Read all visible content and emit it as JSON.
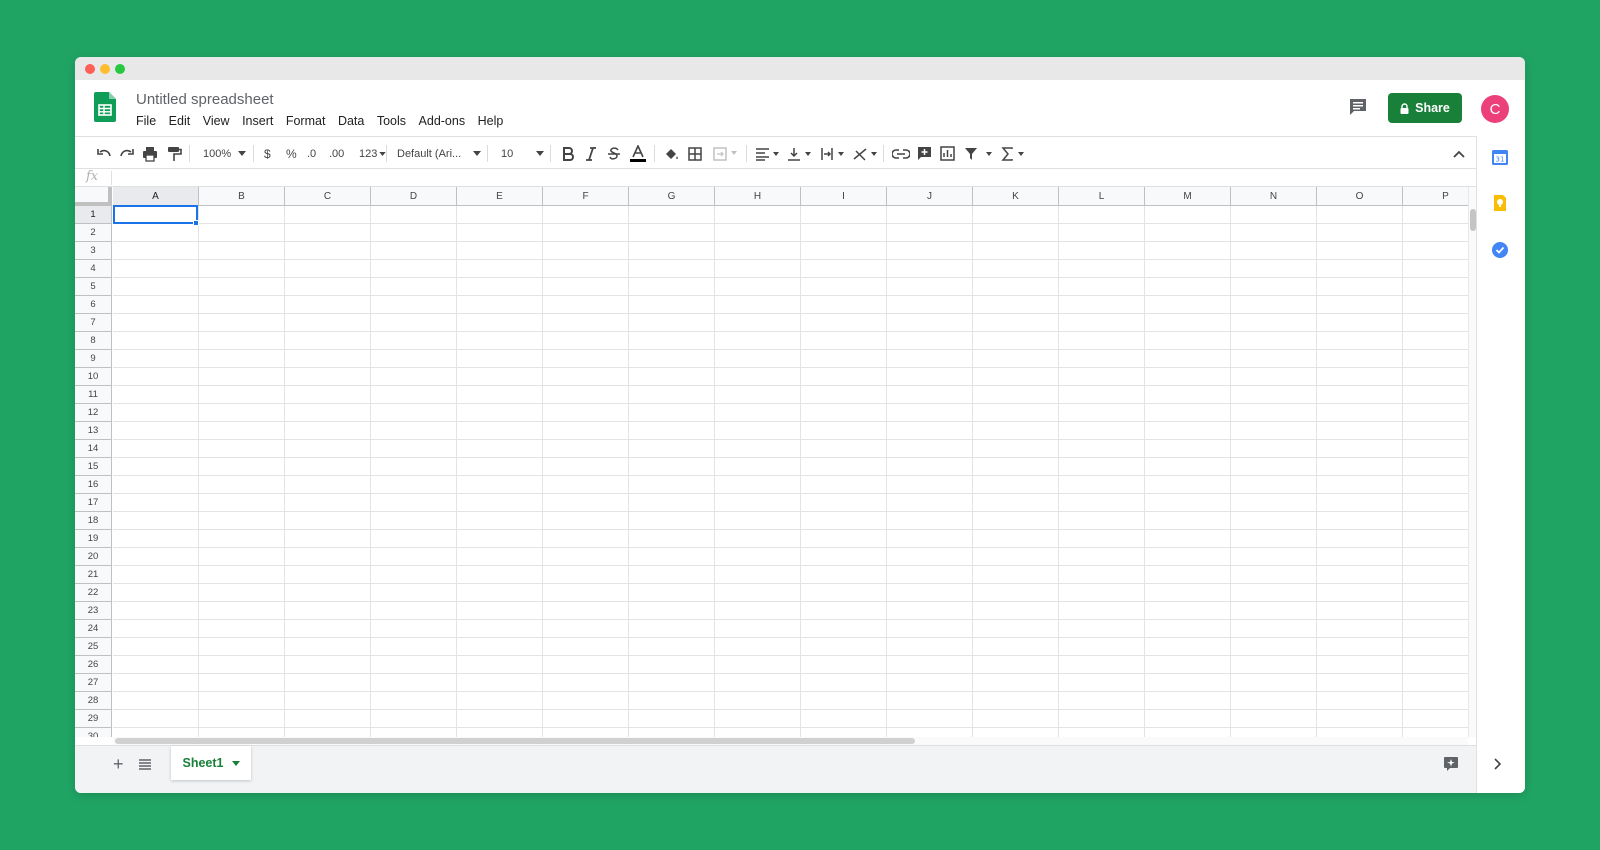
{
  "document": {
    "title": "Untitled spreadsheet"
  },
  "menu": [
    "File",
    "Edit",
    "View",
    "Insert",
    "Format",
    "Data",
    "Tools",
    "Add-ons",
    "Help"
  ],
  "header": {
    "share_label": "Share",
    "avatar_initial": "C"
  },
  "toolbar": {
    "zoom": "100%",
    "currency": "$",
    "percent": "%",
    "decrease_decimal": ".0",
    "increase_decimal": ".00",
    "more_formats": "123",
    "font": "Default (Ari...",
    "font_size": "10"
  },
  "formula_bar": {
    "fx": "fx"
  },
  "grid": {
    "columns": [
      "A",
      "B",
      "C",
      "D",
      "E",
      "F",
      "G",
      "H",
      "I",
      "J",
      "K",
      "L",
      "M",
      "N",
      "O",
      "P"
    ],
    "rows": [
      "1",
      "2",
      "3",
      "4",
      "5",
      "6",
      "7",
      "8",
      "9",
      "10",
      "11",
      "12",
      "13",
      "14",
      "15",
      "16",
      "17",
      "18",
      "19",
      "20",
      "21",
      "22",
      "23",
      "24",
      "25",
      "26",
      "27",
      "28",
      "29",
      "30"
    ],
    "selected_cell": "A1"
  },
  "sheets": {
    "active_tab": "Sheet1"
  },
  "colors": {
    "brand_green": "#188038",
    "selection_blue": "#1a73e8",
    "avatar_pink": "#ec407a",
    "background": "#20a464"
  }
}
